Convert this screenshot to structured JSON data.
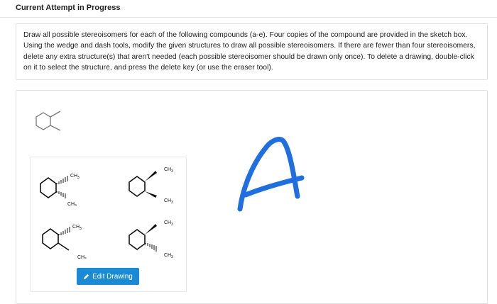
{
  "header": {
    "title": "Current Attempt in Progress"
  },
  "question": {
    "text": "Draw all possible stereoisomers for each of the following compounds (a-e). Four copies of the compound are provided in the sketch box. Using the wedge and dash tools, modify the given structures to draw all possible stereoisomers. If there are fewer than four stereoisomers, delete any extra structure(s) that aren't needed (each possible stereoisomer should be drawn only once). To delete a drawing, double-click on it to select the structure, and press the delete key (or use the eraser tool)."
  },
  "sketch": {
    "molecules": [
      {
        "top": "CH3",
        "bottom": "CH3"
      },
      {
        "top": "CH3",
        "bottom": "CH3"
      },
      {
        "top": "CH3",
        "bottom": "CH3"
      },
      {
        "top": "CH3",
        "bottom": "CH3"
      }
    ],
    "handwritten_letter": "A",
    "handwriting_color": "#1f6fe0",
    "edit_button_label": "Edit Drawing"
  }
}
